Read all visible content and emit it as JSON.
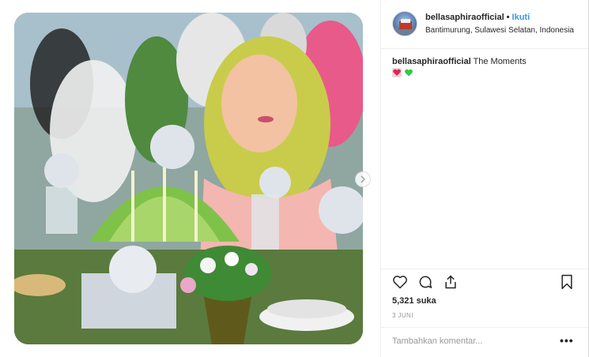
{
  "post": {
    "username": "bellasaphiraofficial",
    "separator": "•",
    "follow_label": "Ikuti",
    "location": "Bantimurung, Sulawesi Selatan, Indonesia",
    "caption_user": "bellasaphiraofficial",
    "caption_text": "The Moments",
    "caption_emojis": [
      "red-heart-icon",
      "green-heart-icon"
    ],
    "likes": "5,321 suka",
    "date": "3 JUNI",
    "comment_placeholder": "Tambahkan komentar...",
    "more_label": "•••"
  },
  "icons": {
    "like": "heart-icon",
    "comment": "comment-icon",
    "share": "share-icon",
    "save": "bookmark-icon"
  },
  "colors": {
    "link": "#3897f0",
    "text": "#262626",
    "muted": "#999999",
    "heart_red": "#e0245e",
    "heart_green": "#2ecc40"
  }
}
